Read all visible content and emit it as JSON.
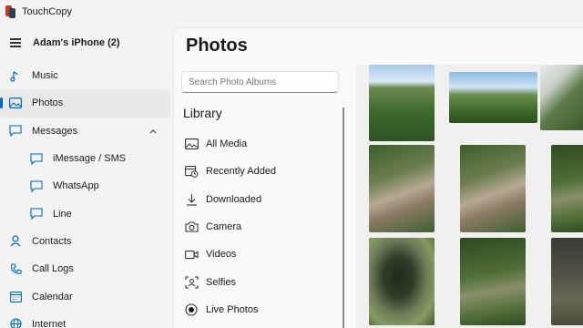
{
  "window": {
    "title": "TouchCopy"
  },
  "nav": {
    "device_name": "Adam's iPhone (2)",
    "items": [
      {
        "label": "Music",
        "icon": "music-note-icon"
      },
      {
        "label": "Photos",
        "icon": "image-icon",
        "active": true
      },
      {
        "label": "Messages",
        "icon": "message-icon",
        "expanded": true
      },
      {
        "label": "iMessage / SMS",
        "icon": "message-icon",
        "sub": true
      },
      {
        "label": "WhatsApp",
        "icon": "message-icon",
        "sub": true
      },
      {
        "label": "Line",
        "icon": "message-icon",
        "sub": true
      },
      {
        "label": "Contacts",
        "icon": "person-icon"
      },
      {
        "label": "Call Logs",
        "icon": "phone-icon"
      },
      {
        "label": "Calendar",
        "icon": "calendar-icon"
      },
      {
        "label": "Internet",
        "icon": "globe-icon"
      }
    ]
  },
  "main": {
    "title": "Photos",
    "search": {
      "placeholder": "Search Photo Albums",
      "value": ""
    },
    "library": {
      "title": "Library",
      "items": [
        {
          "label": "All Media",
          "icon": "image-icon"
        },
        {
          "label": "Recently Added",
          "icon": "calendar-clock-icon"
        },
        {
          "label": "Downloaded",
          "icon": "download-icon"
        },
        {
          "label": "Camera",
          "icon": "camera-icon"
        },
        {
          "label": "Videos",
          "icon": "video-icon"
        },
        {
          "label": "Selfies",
          "icon": "selfie-icon"
        },
        {
          "label": "Live Photos",
          "icon": "live-photo-icon"
        }
      ]
    }
  },
  "colors": {
    "accent": "#0067c0"
  }
}
